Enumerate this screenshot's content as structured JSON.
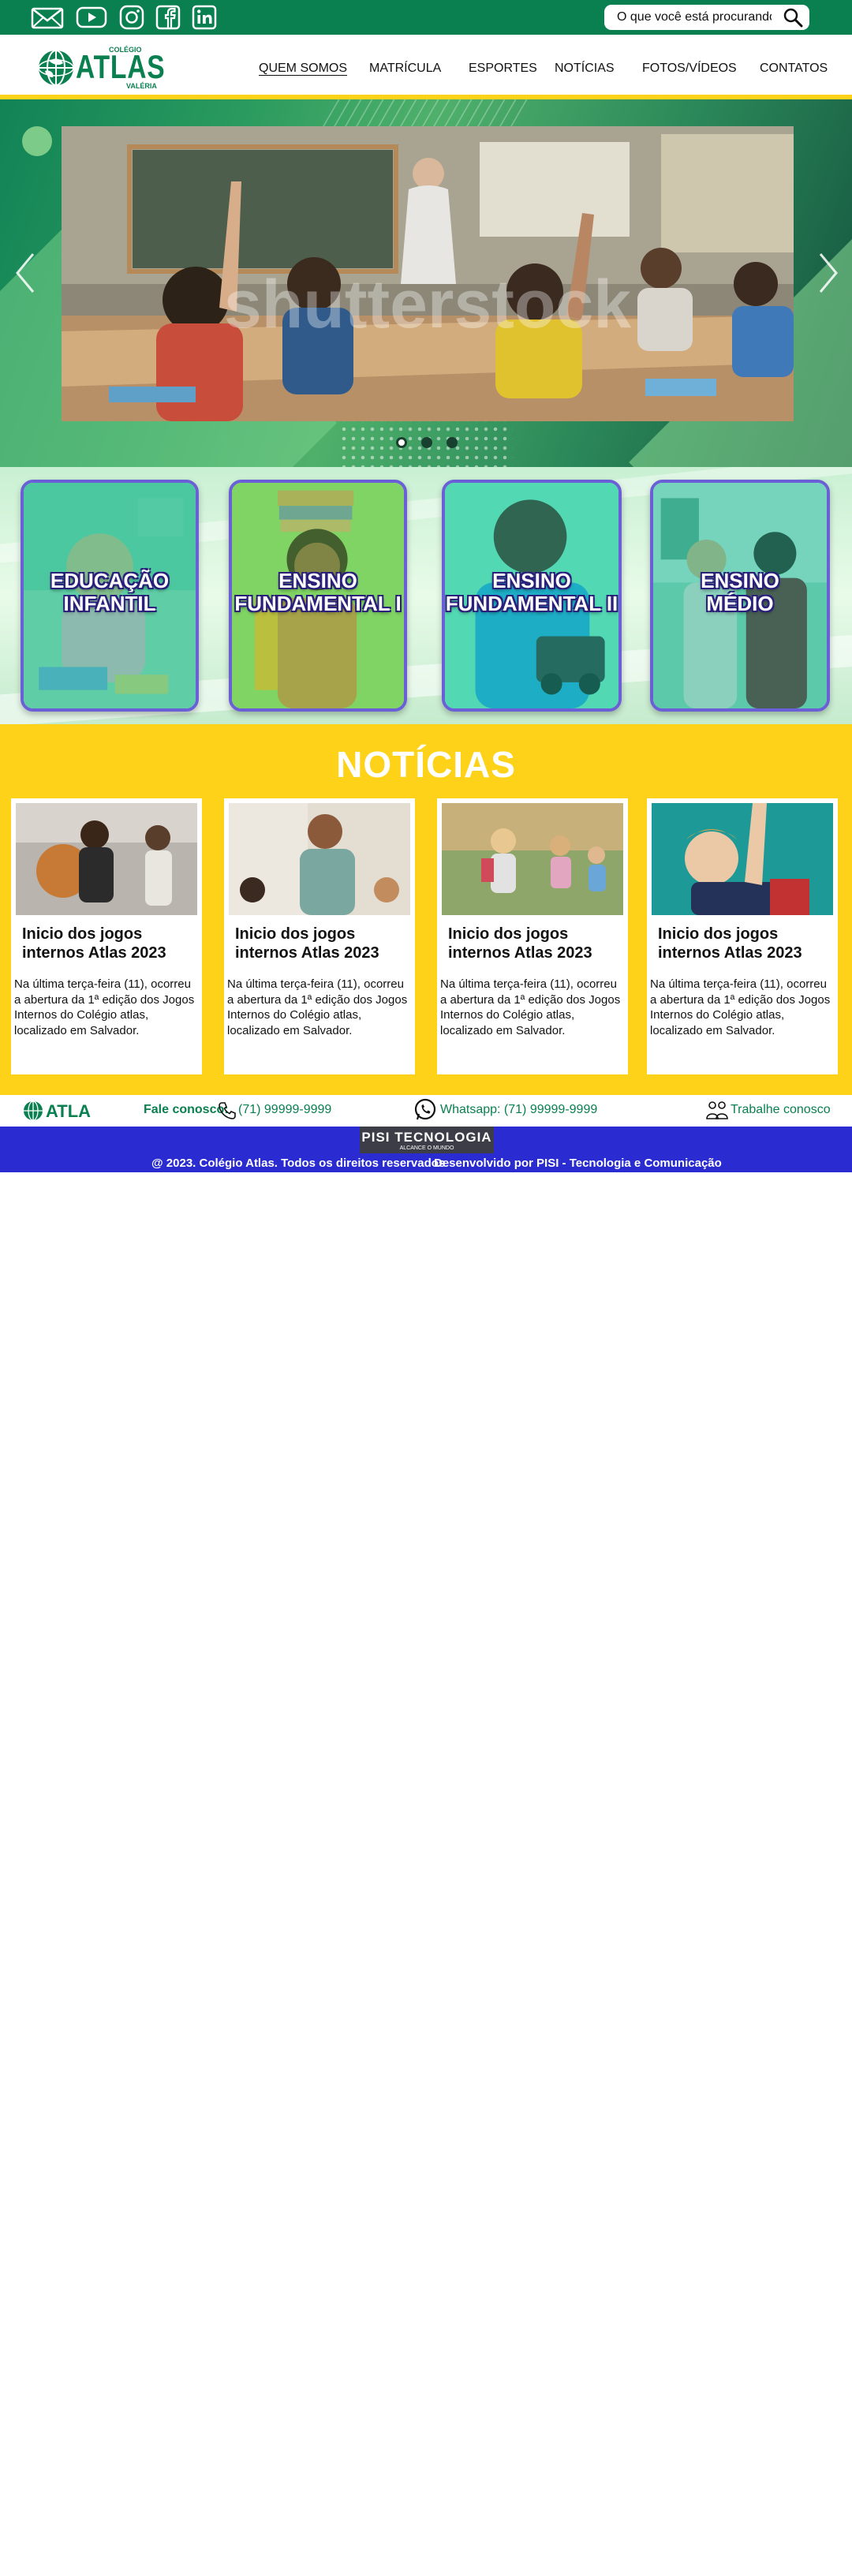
{
  "topbar": {
    "icons": [
      "email-icon",
      "youtube-icon",
      "instagram-icon",
      "facebook-icon",
      "linkedin-icon"
    ],
    "search_placeholder": "O que você está procurando?"
  },
  "logo": {
    "small": "COLÉGIO",
    "name": "ATLAS",
    "sub": "VALÉRIA"
  },
  "nav": {
    "items": [
      {
        "label": "QUEM SOMOS",
        "active": true
      },
      {
        "label": "MATRÍCULA",
        "active": false
      },
      {
        "label": "ESPORTES",
        "active": false
      },
      {
        "label": "NOTÍCIAS",
        "active": false
      },
      {
        "label": "FOTOS/VÍDEOS",
        "active": false
      },
      {
        "label": "CONTATOS",
        "active": false
      }
    ]
  },
  "hero": {
    "watermark": "shutterstock",
    "slide_count": 3,
    "active_slide": 1
  },
  "levels": [
    {
      "line1": "EDUCAÇÃO",
      "line2": "INFANTIL"
    },
    {
      "line1": "ENSINO",
      "line2": "FUNDAMENTAL I"
    },
    {
      "line1": "ENSINO",
      "line2": "FUNDAMENTAL II"
    },
    {
      "line1": "ENSINO",
      "line2": "MÉDIO"
    }
  ],
  "news": {
    "title": "NOTÍCIAS",
    "cards": [
      {
        "title": "Inicio dos jogos internos Atlas 2023",
        "text": "Na última terça-feira (11), ocorreu a abertura da 1ª edição dos Jogos Internos do Colégio atlas, localizado em Salvador."
      },
      {
        "title": "Inicio dos jogos internos Atlas 2023",
        "text": "Na última terça-feira (11), ocorreu a abertura da 1ª edição dos Jogos Internos do Colégio atlas, localizado em Salvador."
      },
      {
        "title": "Inicio dos jogos internos Atlas 2023",
        "text": "Na última terça-feira (11), ocorreu a abertura da 1ª edição dos Jogos Internos do Colégio atlas, localizado em Salvador."
      },
      {
        "title": "Inicio dos jogos internos Atlas 2023",
        "text": "Na última terça-feira (11), ocorreu a abertura da 1ª edição dos Jogos Internos do Colégio atlas, localizado em Salvador."
      }
    ]
  },
  "contact": {
    "label": "Fale conosco:",
    "phone": "(71) 99999-9999",
    "whatsapp": "Whatsapp: (71) 99999-9999",
    "work": "Trabalhe conosco"
  },
  "footer": {
    "brand": "PISI TECNOLOGIA",
    "slogan": "ALCANCE O MUNDO",
    "copyright": "@ 2023. Colégio Atlas. Todos os direitos reservados",
    "dev": "Desenvolvido por PISI - Tecnologia e Comunicação"
  },
  "colors": {
    "green": "#0a8050",
    "yellow": "#ffd21a",
    "blue": "#2a2bd0",
    "purple_border": "#6a5fd6"
  }
}
